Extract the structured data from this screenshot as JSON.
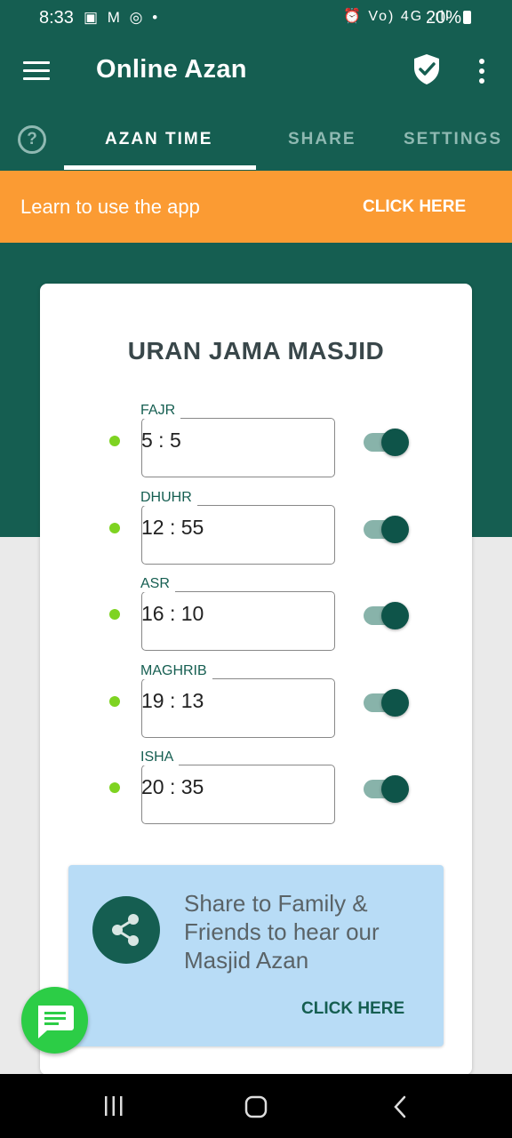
{
  "status_bar": {
    "time": "8:33",
    "left_icons": "▣ M ◎ •",
    "right_icons": "⏰ Vo) 4G .ıll",
    "battery": "20%"
  },
  "app_bar": {
    "title": "Online Azan",
    "menu_icon": "menu-icon",
    "shield_icon": "shield-check-icon",
    "more_icon": "more-vert-icon"
  },
  "tabs": [
    {
      "label": "AZAN TIME",
      "active": true
    },
    {
      "label": "SHARE",
      "active": false
    },
    {
      "label": "SETTINGS",
      "active": false
    }
  ],
  "help_icon": "?",
  "learn_banner": {
    "text": "Learn to use the app",
    "cta": "CLICK HERE",
    "color": "#fb9b33"
  },
  "masjid": {
    "name": "URAN JAMA MASJID"
  },
  "prayers": [
    {
      "label": "FAJR",
      "time": "5 : 5",
      "enabled": true
    },
    {
      "label": "DHUHR",
      "time": "12 : 55",
      "enabled": true
    },
    {
      "label": "ASR",
      "time": "16 : 10",
      "enabled": true
    },
    {
      "label": "MAGHRIB",
      "time": "19 : 13",
      "enabled": true
    },
    {
      "label": "ISHA",
      "time": "20 : 35",
      "enabled": true
    }
  ],
  "share": {
    "text": "Share to Family & Friends to hear our Masjid Azan",
    "cta": "CLICK HERE",
    "icon": "share-icon"
  },
  "chat_icon": "chat-icon",
  "colors": {
    "primary": "#155e51",
    "accent": "#fb9b33",
    "dot": "#7ed321",
    "share_bg": "#b8dcf6",
    "fab": "#2ccd46"
  }
}
